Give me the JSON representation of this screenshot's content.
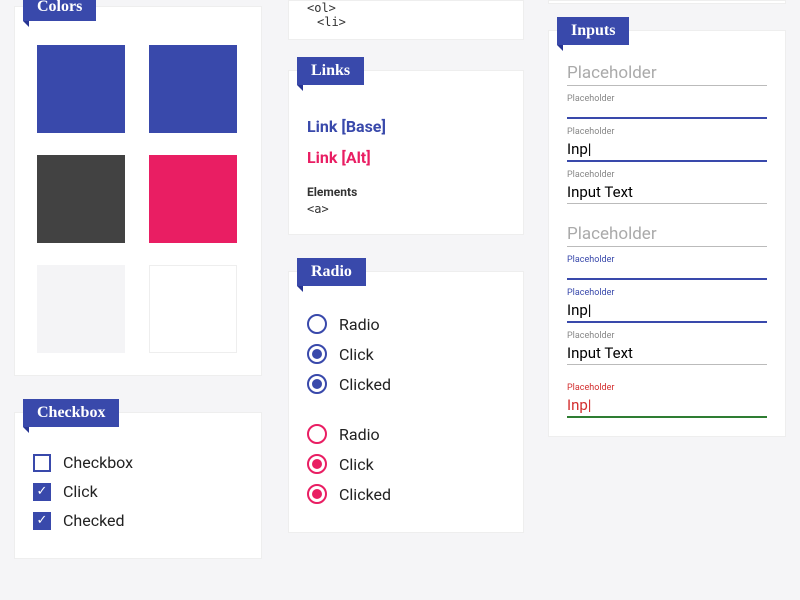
{
  "colors_card": {
    "title": "Colors",
    "swatches": [
      "#3949ab",
      "#3949ab",
      "#424242",
      "#e91e63",
      "#f4f4f6",
      "#ffffff"
    ]
  },
  "checkbox_card": {
    "title": "Checkbox",
    "items": [
      {
        "label": "Checkbox",
        "state": "empty"
      },
      {
        "label": "Click",
        "state": "checked-halo"
      },
      {
        "label": "Checked",
        "state": "checked"
      }
    ]
  },
  "partial_list": {
    "line1": "<ol>",
    "line2": "  <li>"
  },
  "links_card": {
    "title": "Links",
    "base": "Link [Base]",
    "alt": "Link [Alt]",
    "elements_heading": "Elements",
    "element_tag": "<a>"
  },
  "radio_card": {
    "title": "Radio",
    "blue": [
      {
        "label": "Radio",
        "state": "empty"
      },
      {
        "label": "Click",
        "state": "filled-halo"
      },
      {
        "label": "Clicked",
        "state": "filled"
      }
    ],
    "pink": [
      {
        "label": "Radio",
        "state": "empty"
      },
      {
        "label": "Click",
        "state": "filled-halo"
      },
      {
        "label": "Clicked",
        "state": "filled"
      }
    ]
  },
  "inputs_card": {
    "title": "Inputs",
    "placeholder_text": "Placeholder",
    "typing_value": "Inp",
    "filled_value": "Input Text"
  }
}
